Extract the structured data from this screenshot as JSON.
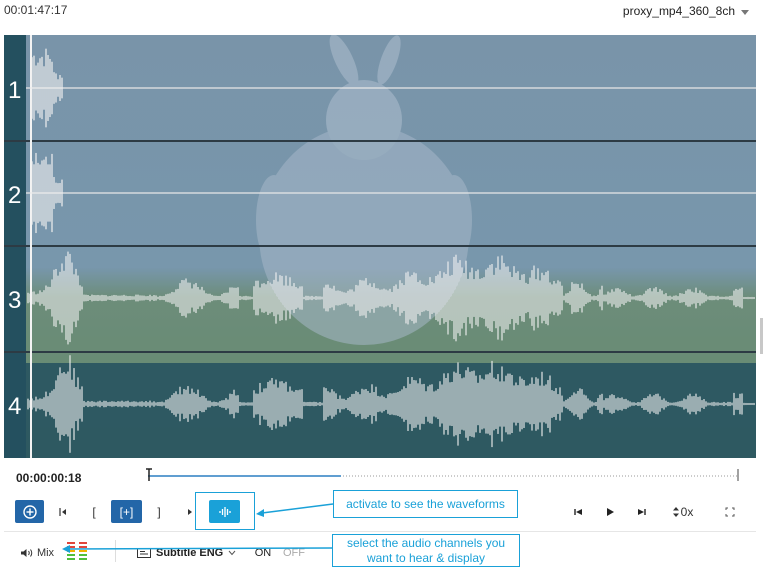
{
  "header": {
    "timecode": "00:01:47:17",
    "proxy_label": "proxy_mp4_360_8ch"
  },
  "player": {
    "channels": [
      "1",
      "2",
      "3",
      "4"
    ],
    "overlay_color": "#6f8ba0",
    "highlight_color": "#24505f"
  },
  "transport": {
    "current_time": "00:00:00:18",
    "progress": 0.0,
    "add_marker_label": "+",
    "mark_in_label": "[",
    "mark_out_label": "]",
    "add_range_label": "[+]",
    "speed_label": "0x",
    "waveform_icon": "waveform-icon"
  },
  "footer": {
    "audio_mix_label": "Mix",
    "subtitle_label": "Subtitle ENG",
    "on_label": "ON",
    "off_label": "OFF"
  },
  "annotations": {
    "waveform_callout": "activate to see the waveforms",
    "channels_callout_line1": "select the audio channels you",
    "channels_callout_line2": "want to hear & display",
    "accent": "#1aa1d8"
  }
}
